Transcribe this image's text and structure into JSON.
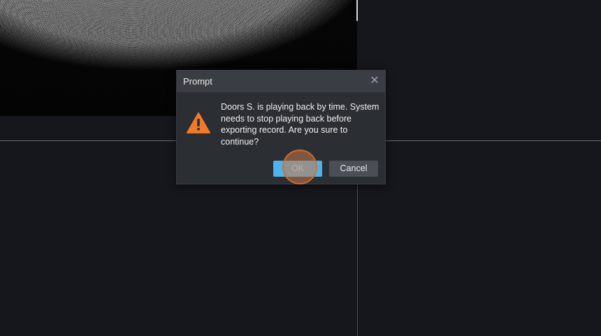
{
  "dialog": {
    "title": "Prompt",
    "close_glyph": "✕",
    "message": "Doors S. is playing back by time. System needs to stop playing back before exporting record. Are you sure to continue?",
    "ok_label": "OK",
    "cancel_label": "Cancel"
  },
  "icons": {
    "warning": "warning-icon",
    "close": "close-icon"
  },
  "colors": {
    "background": "#15171c",
    "dialog_body": "#2b2e33",
    "dialog_header": "#3a3d43",
    "ok_button": "#4db3ea",
    "cancel_button": "#4a4e55",
    "warning": "#f07a2a",
    "click_marker": "#d06e32"
  }
}
